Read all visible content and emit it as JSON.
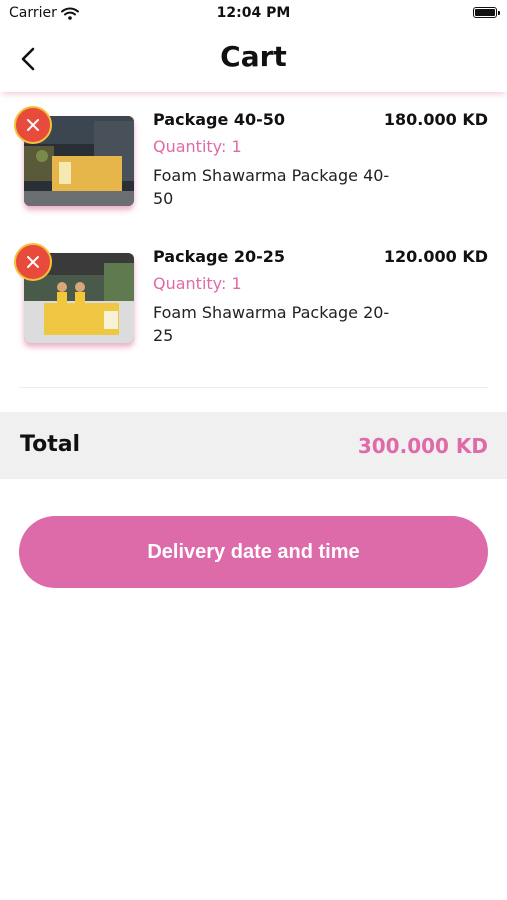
{
  "status_bar": {
    "carrier": "Carrier",
    "time": "12:04 PM"
  },
  "header": {
    "title": "Cart",
    "back_icon": "chevron-left-icon"
  },
  "cart": {
    "items": [
      {
        "name": "Package 40-50",
        "price": "180.000 KD",
        "quantity": "Quantity: 1",
        "description": "Foam Shawarma Package 40-50",
        "remove_icon": "close-icon"
      },
      {
        "name": "Package 20-25",
        "price": "120.000 KD",
        "quantity": "Quantity: 1",
        "description": "Foam Shawarma Package 20-25",
        "remove_icon": "close-icon"
      }
    ]
  },
  "summary": {
    "label": "Total",
    "value": "300.000 KD"
  },
  "actions": {
    "delivery_label": "Delivery date and time"
  },
  "colors": {
    "accent": "#dd6aa9",
    "accent_text": "#e06aa8",
    "remove": "#e84a3c",
    "total_bg": "#f0f0f0"
  }
}
